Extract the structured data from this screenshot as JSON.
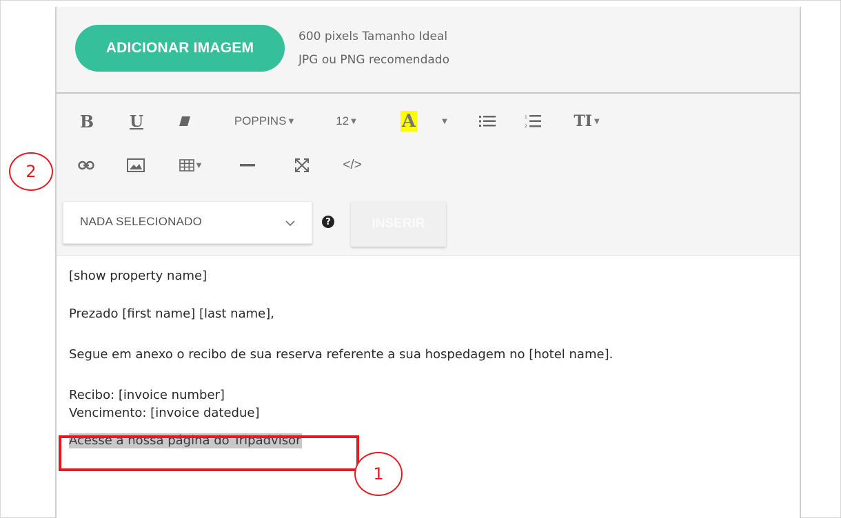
{
  "image_section": {
    "button_label": "ADICIONAR IMAGEM",
    "hint_line1": "600 pixels Tamanho Ideal",
    "hint_line2": "JPG ou PNG recomendado"
  },
  "toolbar": {
    "bold": "B",
    "underline": "U",
    "font_family": "POPPINS",
    "font_size": "12",
    "font_color_letter": "A",
    "font_color_swatch": "#ffff00",
    "text_height_label": "TI",
    "code_view": "</>"
  },
  "merge_fields": {
    "select_placeholder": "NADA SELECIONADO",
    "help_symbol": "?",
    "insert_label": "INSERIR"
  },
  "content": {
    "line1": "[show property name]",
    "line2": "Prezado [first name] [last name],",
    "line3": "Segue em anexo o recibo de sua reserva referente a sua hospedagem no [hotel name].",
    "line4": "Recibo: [invoice number]",
    "line5": "Vencimento: [invoice datedue]",
    "line6": "Acesse a nossa página do Tripadvisor"
  },
  "annotations": {
    "callout_1": "1",
    "callout_2": "2",
    "color": "#e8181f"
  },
  "colors": {
    "accent": "#35bf9a",
    "selection": "#c8c8c8"
  }
}
